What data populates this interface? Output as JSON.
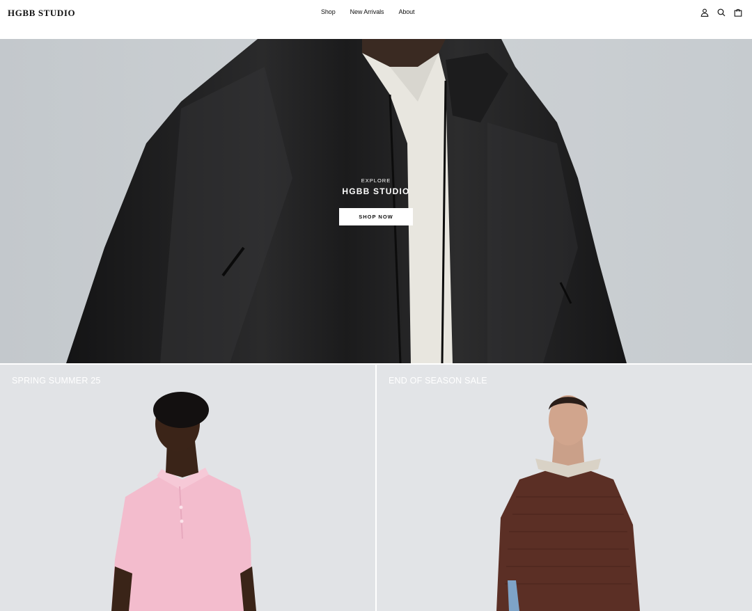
{
  "brand": {
    "name": "HGBB STUDIO"
  },
  "nav": {
    "items": [
      "Shop",
      "New Arrivals",
      "About"
    ]
  },
  "header_icons": [
    "account-icon",
    "search-icon",
    "bag-icon"
  ],
  "hero": {
    "eyebrow": "EXPLORE",
    "title": "HGBB STUDIO",
    "cta_label": "SHOP NOW"
  },
  "tiles": [
    {
      "label": "SPRING SUMMER 25"
    },
    {
      "label": "END OF SEASON SALE"
    }
  ],
  "colors": {
    "text": "#111111",
    "background": "#ffffff",
    "hero_bg": "#c8ccd0",
    "tile_bg": "#e1e3e6",
    "jacket": "#1f1f20",
    "pink_polo": "#f1b9cc",
    "brown_sweater": "#5a2e24"
  }
}
